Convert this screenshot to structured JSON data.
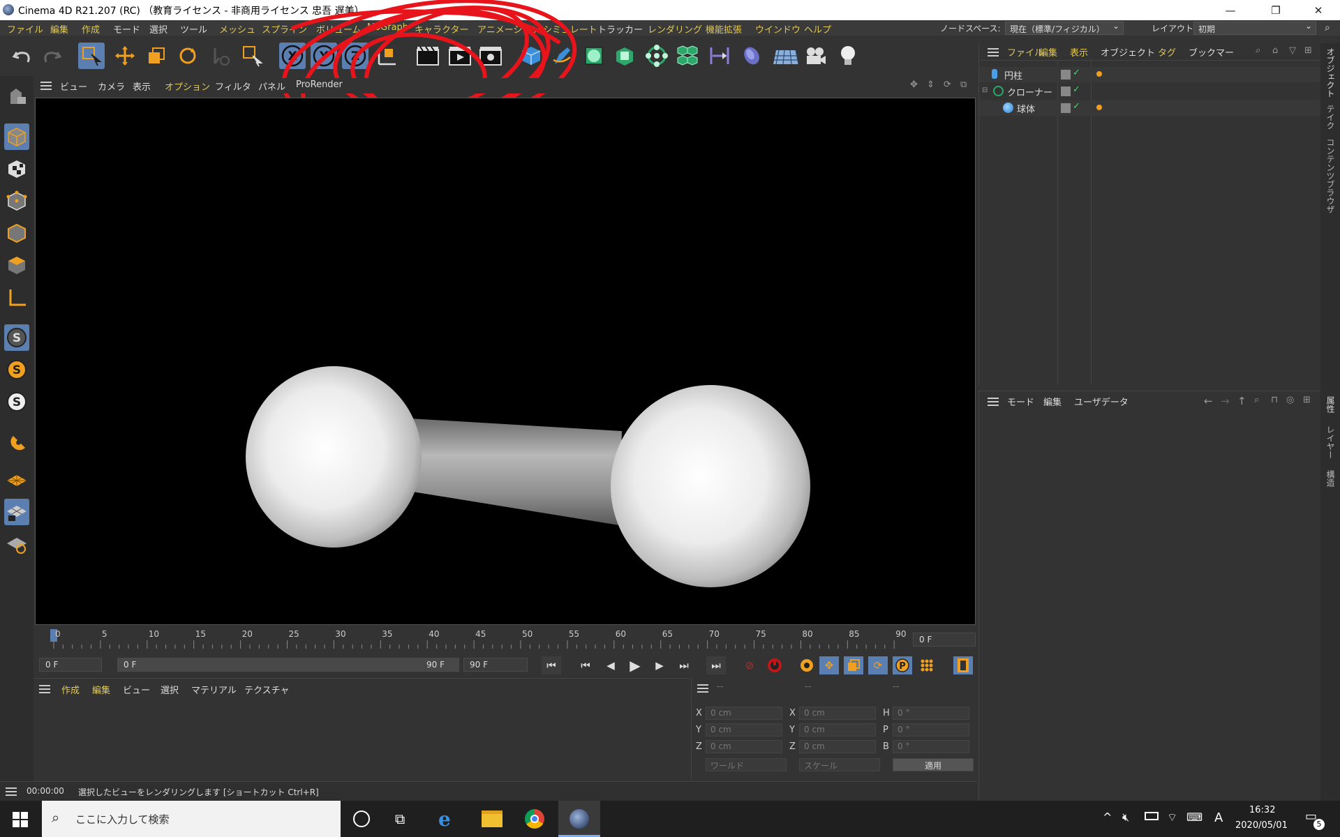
{
  "window": {
    "title": "Cinema 4D R21.207 (RC)  （教育ライセンス - 非商用ライセンス 忠吾 遅美）",
    "minimize": "—",
    "maximize": "❐",
    "close": "✕"
  },
  "menubar": {
    "items": [
      "ファイル",
      "編集",
      "作成",
      "モード",
      "選択",
      "ツール",
      "メッシュ",
      "スプライン",
      "ボリューム",
      "MoGraph",
      "キャラクター",
      "アニメーション",
      "シミュレート",
      "トラッカー",
      "レンダリング",
      "機能拡張",
      "ウインドウ",
      "ヘルプ"
    ],
    "node_space_label": "ノードスペース:",
    "node_space_value": "現在（標準/フィジカル）",
    "layout_label": "レイアウト:",
    "layout_value": "初期"
  },
  "viewport_menu": [
    "ビュー",
    "カメラ",
    "表示",
    "オプション",
    "フィルタ",
    "パネル",
    "ProRender"
  ],
  "toolbar": {
    "x_label": "X",
    "y_label": "Y",
    "z_label": "Z"
  },
  "left_tools": {
    "s_label": "S"
  },
  "timeline": {
    "ticks": [
      "0",
      "5",
      "10",
      "15",
      "20",
      "25",
      "30",
      "35",
      "40",
      "45",
      "50",
      "55",
      "60",
      "65",
      "70",
      "75",
      "80",
      "85",
      "90"
    ],
    "current_frame": "0 F"
  },
  "time_controls": {
    "start": "0 F",
    "range_start": "0 F",
    "range_end": "90 F",
    "end": "90 F",
    "p_label": "P"
  },
  "material_panel": {
    "menu": [
      "作成",
      "編集",
      "ビュー",
      "選択",
      "マテリアル",
      "テクスチャ"
    ]
  },
  "coord_panel": {
    "headers": [
      "--",
      "--",
      "--"
    ],
    "rows": [
      {
        "a": "X",
        "av": "0 cm",
        "b": "X",
        "bv": "0 cm",
        "c": "H",
        "cv": "0 °"
      },
      {
        "a": "Y",
        "av": "0 cm",
        "b": "Y",
        "bv": "0 cm",
        "c": "P",
        "cv": "0 °"
      },
      {
        "a": "Z",
        "av": "0 cm",
        "b": "Z",
        "bv": "0 cm",
        "c": "B",
        "cv": "0 °"
      }
    ],
    "world": "ワールド",
    "scale": "スケール",
    "apply": "適用"
  },
  "statusbar": {
    "time": "00:00:00",
    "message": "選択したビューをレンダリングします [ショートカット Ctrl+R]"
  },
  "object_manager": {
    "menu": [
      "ファイル",
      "編集",
      "表示",
      "オブジェクト",
      "タグ",
      "ブックマー"
    ],
    "objects": [
      {
        "name": "円柱",
        "indent": 0
      },
      {
        "name": "クローナー",
        "indent": 0
      },
      {
        "name": "球体",
        "indent": 1
      }
    ]
  },
  "attribute_manager": {
    "menu": [
      "モード",
      "編集",
      "ユーザデータ"
    ]
  },
  "right_tabs": [
    "オブジェクト",
    "テイク",
    "コンテンツブラウザ",
    "属性",
    "レイヤー",
    "構造"
  ],
  "taskbar": {
    "search_placeholder": "ここに入力して検索",
    "time": "16:32",
    "date": "2020/05/01",
    "ime": "A",
    "notification_count": "5"
  },
  "colors": {
    "menu_yellow": "#e0c95a",
    "selection_blue": "#5a7fb0",
    "annotation_red": "#e8141c",
    "timeline_marker": "#5a7fb0"
  }
}
